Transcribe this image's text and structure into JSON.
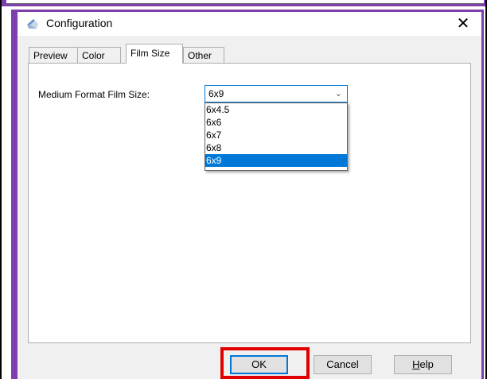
{
  "window": {
    "title": "Configuration",
    "close_symbol": "✕"
  },
  "tabs": [
    {
      "label": "Preview"
    },
    {
      "label": "Color"
    },
    {
      "label": "Film Size"
    },
    {
      "label": "Other"
    }
  ],
  "active_tab": "Film Size",
  "film_size": {
    "label": "Medium Format Film Size:",
    "selected": "6x9",
    "options": [
      "6x4.5",
      "6x6",
      "6x7",
      "6x8",
      "6x9"
    ]
  },
  "buttons": {
    "ok": "OK",
    "cancel": "Cancel",
    "help_underlined": "H",
    "help_rest": "elp"
  },
  "colors": {
    "frame": "#7e3fae",
    "selection": "#0078d7",
    "highlight": "#e00000"
  }
}
